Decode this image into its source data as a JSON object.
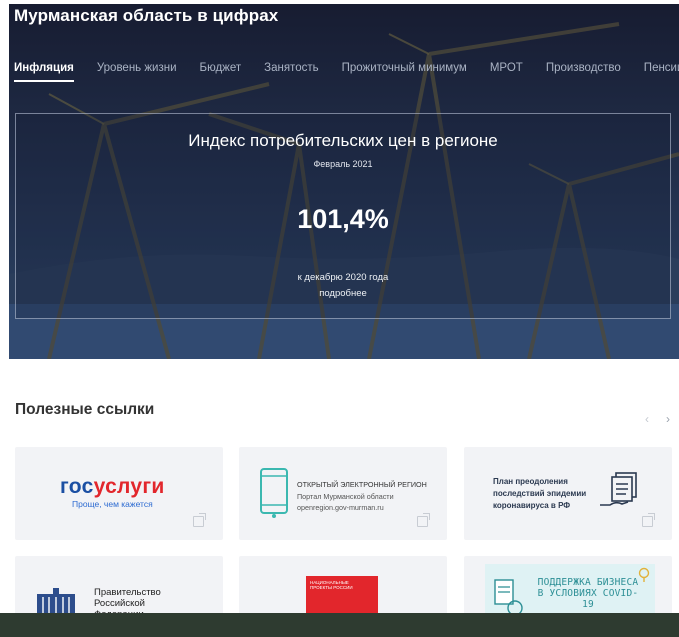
{
  "hero": {
    "title": "Мурманская область в цифрах",
    "tabs": [
      {
        "label": "Инфляция",
        "active": true
      },
      {
        "label": "Уровень жизни",
        "active": false
      },
      {
        "label": "Бюджет",
        "active": false
      },
      {
        "label": "Занятость",
        "active": false
      },
      {
        "label": "Прожиточный минимум",
        "active": false
      },
      {
        "label": "МРОТ",
        "active": false
      },
      {
        "label": "Производство",
        "active": false
      },
      {
        "label": "Пенсии",
        "active": false
      }
    ],
    "panel": {
      "title": "Индекс потребительских цен в регионе",
      "date": "Февраль 2021",
      "value": "101,4%",
      "note": "к декабрю 2020 года",
      "more_link": "подробнее"
    }
  },
  "links": {
    "title": "Полезные ссылки",
    "prev_arrow": "‹",
    "next_arrow": "›",
    "cards": [
      {
        "logo_part1": "гос",
        "logo_part2": "услуги",
        "subtitle": "Проще, чем кажется"
      },
      {
        "title": "ОТКРЫТЫЙ ЭЛЕКТРОННЫЙ РЕГИОН",
        "subtitle": "Портал Мурманской области",
        "url": "openregion.gov-murman.ru"
      },
      {
        "text": "План преодоления последствий эпидемии коронавируса в РФ"
      },
      {
        "text": "Правительство Российской Федерации"
      },
      {
        "text": "НАЦИОНАЛЬНЫЕ ПРОЕКТЫ РОССИИ"
      },
      {
        "text": "ПОДДЕРЖКА БИЗНЕСА В УСЛОВИЯХ COVID-19"
      }
    ]
  },
  "colors": {
    "hero_bg": "#1d2a48",
    "accent_blue": "#1b4fa3",
    "accent_red": "#e2262c",
    "covid_teal": "#2c8f95",
    "card_bg": "#f2f3f6"
  }
}
